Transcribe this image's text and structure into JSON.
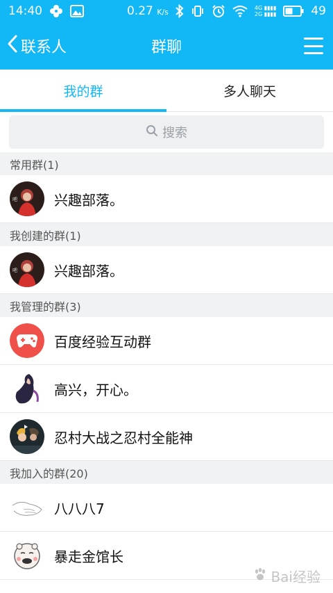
{
  "status_bar": {
    "time": "14:40",
    "speed": "0.27",
    "speed_unit": "K/s",
    "net_4g": "4G",
    "net_2g": "2G",
    "battery": "49"
  },
  "nav": {
    "back_label": "联系人",
    "title": "群聊"
  },
  "tabs": [
    {
      "label": "我的群",
      "active": true
    },
    {
      "label": "多人聊天",
      "active": false
    }
  ],
  "search": {
    "placeholder": "搜索"
  },
  "sections": [
    {
      "title": "常用群(1)",
      "items": [
        {
          "name": "兴趣部落。",
          "avatar": "woman-red-avatar"
        }
      ]
    },
    {
      "title": "我创建的群(1)",
      "items": [
        {
          "name": "兴趣部落。",
          "avatar": "woman-red-avatar"
        }
      ]
    },
    {
      "title": "我管理的群(3)",
      "items": [
        {
          "name": "百度经验互动群",
          "avatar": "gamepad-avatar"
        },
        {
          "name": "高兴，开心。",
          "avatar": "anime-figure-avatar"
        },
        {
          "name": "忍村大战之忍村全能神",
          "avatar": "anime-video-avatar"
        }
      ]
    },
    {
      "title": "我加入的群(20)",
      "items": [
        {
          "name": "八八八7",
          "avatar": "hand-sketch-avatar"
        },
        {
          "name": "暴走金馆长",
          "avatar": "meme-face-avatar"
        }
      ]
    }
  ],
  "avatar_labels": {
    "woman_red_1": "吧",
    "woman_red_2": "吧"
  },
  "watermark": {
    "text": "Bai经验"
  },
  "colors": {
    "brand": "#12b7f5",
    "section_bg": "#f1f2f4",
    "gamepad_red": "#f0504a"
  }
}
